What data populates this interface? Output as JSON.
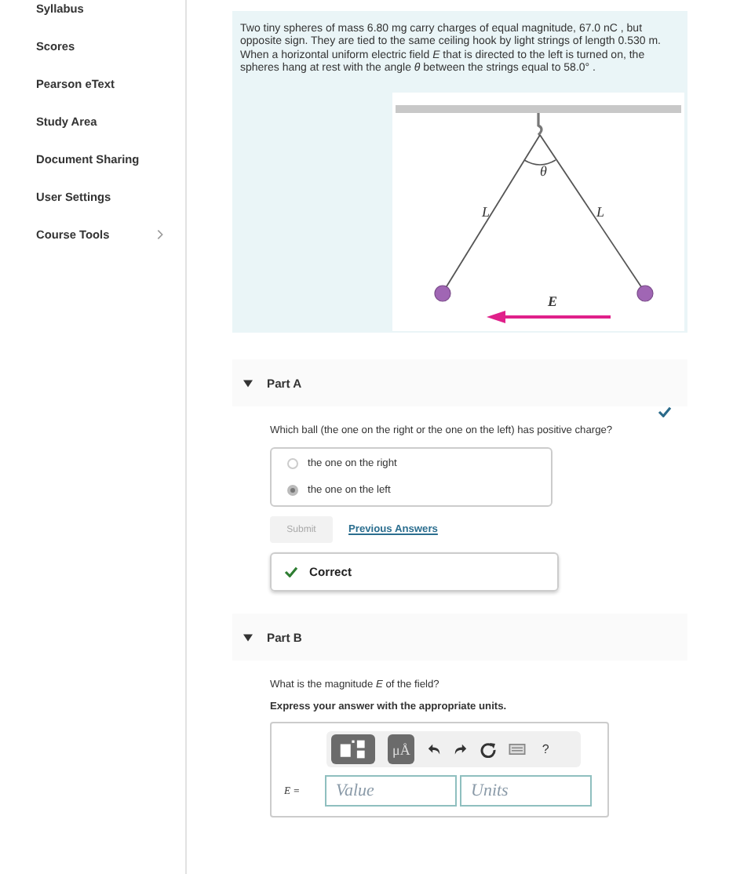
{
  "sidebar": {
    "items": [
      {
        "label": "Syllabus",
        "has_submenu": false
      },
      {
        "label": "Scores",
        "has_submenu": false
      },
      {
        "label": "Pearson eText",
        "has_submenu": false
      },
      {
        "label": "Study Area",
        "has_submenu": false
      },
      {
        "label": "Document Sharing",
        "has_submenu": false
      },
      {
        "label": "User Settings",
        "has_submenu": false
      },
      {
        "label": "Course Tools",
        "has_submenu": true
      }
    ]
  },
  "problem": {
    "text": "Two tiny spheres of mass 6.80 mg carry charges of equal magnitude, 67.0 nC , but opposite sign. They are tied to the same ceiling hook by light strings of length 0.530 m. When a horizontal uniform electric field *E* that is directed to the left is turned on, the spheres hang at rest with the angle *θ* between the strings equal to 58.0° .",
    "figure": {
      "angle_label": "θ",
      "left_string_label": "L",
      "right_string_label": "L",
      "field_label": "E"
    }
  },
  "parts": [
    {
      "kind": "choice",
      "title": "Part A",
      "expanded": true,
      "completed": true,
      "question": "Which ball (the one on the right or the one on the left) has positive charge?",
      "options": [
        {
          "label": "the one on the right",
          "selected": false
        },
        {
          "label": "the one on the left",
          "selected": true
        }
      ],
      "submit_label": "Submit",
      "submit_disabled": true,
      "link": "Previous Answers",
      "feedback": "Correct"
    },
    {
      "kind": "value",
      "title": "Part B",
      "expanded": true,
      "completed": false,
      "question": "What is the magnitude *E* of the field?",
      "instruction": "Express your answer with the appropriate units.",
      "unit_button": "μÅ",
      "help": "?",
      "variable": "E =",
      "value_placeholder": "Value",
      "units_placeholder": "Units"
    }
  ]
}
